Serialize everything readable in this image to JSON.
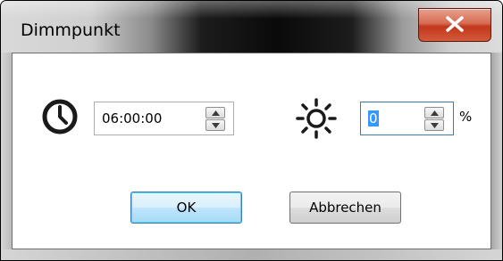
{
  "window": {
    "title": "Dimmpunkt",
    "close_icon": "close-x-icon"
  },
  "time_field": {
    "icon": "clock-icon",
    "value": "06:00:00",
    "spin_up_icon": "spin-up-arrow-icon",
    "spin_down_icon": "spin-down-arrow-icon"
  },
  "brightness_field": {
    "icon": "sun-icon",
    "value": "0",
    "unit": "%",
    "spin_up_icon": "spin-up-arrow-icon",
    "spin_down_icon": "spin-down-arrow-icon"
  },
  "buttons": {
    "ok_label": "OK",
    "cancel_label": "Abbrechen"
  },
  "colors": {
    "close_button": "#c2371c",
    "selection": "#3399ff",
    "ok_focus": "#3c7fb1"
  }
}
